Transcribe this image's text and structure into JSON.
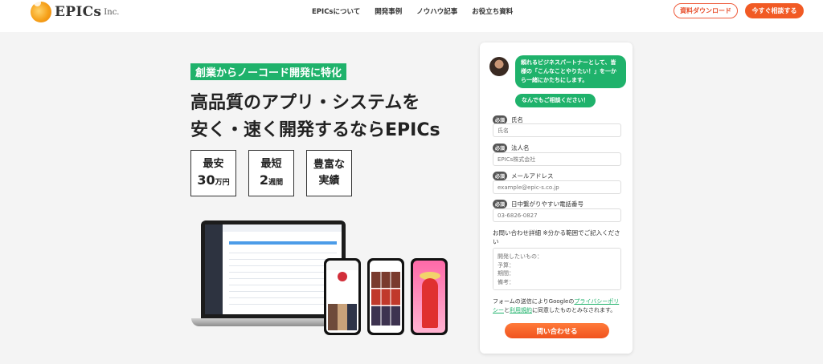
{
  "header": {
    "logo_text": "EPICs",
    "logo_sub": "Inc.",
    "nav": [
      "EPICsについて",
      "開発事例",
      "ノウハウ記事",
      "お役立ち資料"
    ],
    "download_button": "資料ダウンロード",
    "consult_button": "今すぐ相談する",
    "accent_color": "#f15a24"
  },
  "hero": {
    "tag": "創業からノーコード開発に特化",
    "headline_line1": "高品質のアプリ・システムを",
    "headline_line2": "安く・速く開発するならEPICs",
    "badges": [
      {
        "line1": "最安",
        "value": "30",
        "unit": "万円"
      },
      {
        "line1": "最短",
        "value": "2",
        "unit": "週間"
      },
      {
        "line1": "豊富な",
        "line2": "実績"
      }
    ],
    "brand_green": "#1fb26b"
  },
  "form": {
    "chat_message": "頼れるビジネスパートナーとして、皆様の「こんなことやりたい！」を一から一緒にかたちにします。",
    "chat_message2": "なんでもご相談ください！",
    "required_label": "必須",
    "fields": [
      {
        "label": "氏名",
        "placeholder": "氏名"
      },
      {
        "label": "法人名",
        "placeholder": "EPICs株式会社"
      },
      {
        "label": "メールアドレス",
        "placeholder": "example@epic-s.co.jp"
      },
      {
        "label": "日中繋がりやすい電話番号",
        "placeholder": "03-6826-0827"
      }
    ],
    "detail_label": "お問い合わせ詳細 ※分かる範囲でご記入ください",
    "detail_placeholder": "開発したいもの：\n予算：\n期間：\n備考：",
    "consent_prefix": "フォームの送信によりGoogleの",
    "privacy_link": "プライバシーポリシー",
    "consent_mid": "と",
    "terms_link": "利用規約",
    "consent_suffix": "に同意したものとみなされます。",
    "submit_label": "問い合わせる"
  }
}
